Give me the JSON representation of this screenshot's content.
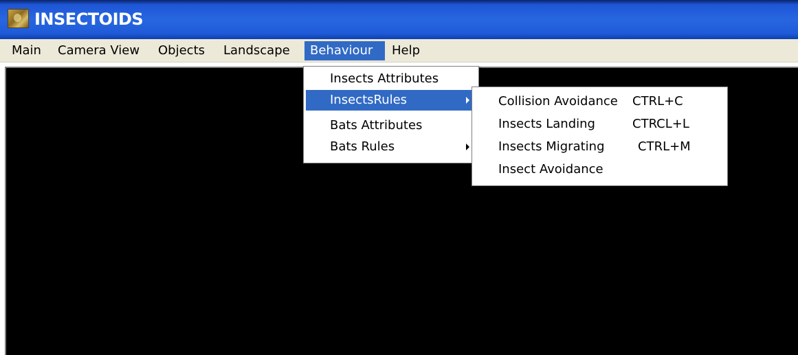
{
  "window": {
    "title": "INSECTOIDS"
  },
  "menubar": {
    "items": [
      {
        "label": "Main"
      },
      {
        "label": "Camera View"
      },
      {
        "label": "Objects"
      },
      {
        "label": "Landscape"
      },
      {
        "label": "Behaviour"
      },
      {
        "label": "Help"
      }
    ]
  },
  "behaviour_menu": {
    "items": [
      {
        "label": "Insects Attributes"
      },
      {
        "label": "InsectsRules"
      },
      {
        "label": "Bats Attributes"
      },
      {
        "label": "Bats Rules"
      }
    ]
  },
  "insects_rules_submenu": {
    "items": [
      {
        "label": "Collision Avoidance",
        "shortcut": "CTRL+C"
      },
      {
        "label": "Insects Landing",
        "shortcut": "CTRCL+L"
      },
      {
        "label": "Insects Migrating",
        "shortcut": "CTRL+M"
      },
      {
        "label": "Insect Avoidance",
        "shortcut": ""
      }
    ]
  },
  "colors": {
    "titlebar": "#2866e0",
    "menu_highlight": "#316ac5",
    "menubar_bg": "#ece9d8",
    "canvas_bg": "#000000"
  },
  "icons": {
    "app": "insect-app-icon",
    "submenu_arrow": "chevron-right-icon"
  }
}
